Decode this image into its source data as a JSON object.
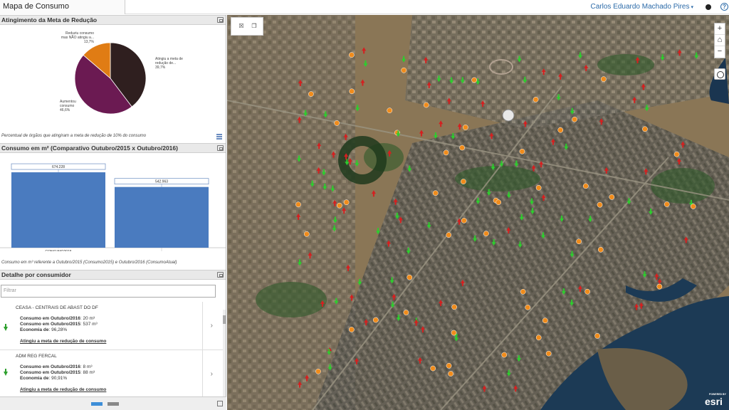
{
  "app": {
    "title": "Mapa de Consumo"
  },
  "header": {
    "user_name": "Carlos Eduardo Machado Pires",
    "caret": "▾"
  },
  "panels": {
    "pie": {
      "title": "Atingimento da Meta de Redução",
      "caption": "Percentual de órgãos que atingiram a meta de redução de 10% do consumo",
      "labels": {
        "reduziu": [
          "Reduziu consumo",
          "mas NÃO atingiu a...",
          "13,7%"
        ],
        "atingiu": [
          "Atingiu a meta de",
          "redução de...",
          "39,7%"
        ],
        "aumentou": [
          "Aumentou",
          "consumo",
          "46,6%"
        ]
      }
    },
    "bar": {
      "title": "Consumo em m² (Comparativo Outubro/2015 x Outubro/2016)",
      "caption": "Consumo em m³ referente a Outubro/2015 (Consumo2015) e Outubro/2016 (ConsumoAtual)"
    },
    "detail": {
      "title": "Detalhe por consumidor",
      "filter_placeholder": "Filtrar"
    }
  },
  "chart_data": [
    {
      "type": "pie",
      "title": "Atingimento da Meta de Redução",
      "slices": [
        {
          "label": "Atingiu a meta de redução de...",
          "value": 39.7,
          "color": "#2f1f1f"
        },
        {
          "label": "Aumentou consumo",
          "value": 46.6,
          "color": "#6b1a52"
        },
        {
          "label": "Reduziu consumo mas NÃO atingiu a...",
          "value": 13.7,
          "color": "#e07c14"
        }
      ]
    },
    {
      "type": "bar",
      "title": "Consumo em m² (Comparativo Outubro/2015 x Outubro/2016)",
      "categories": [
        "CONSUMO2015",
        "CONSUMOATUAL"
      ],
      "values": [
        674228,
        542963
      ],
      "value_labels": [
        "674.228",
        "542.963"
      ],
      "color": "#4a7bbf"
    }
  ],
  "consumers": [
    {
      "name": "CEASA - CENTRAIS DE ABAST DO DF",
      "l1_label": "Consumo em Outubro/2016",
      "l1_value": ": 20 m³",
      "l2_label": "Consumo em Outubro/2015",
      "l2_value": ": 537 m³",
      "l3_label": "Economia de",
      "l3_value": ": 96,28%",
      "status": "Atingiu a meta de redução de consumo"
    },
    {
      "name": "ADM REG FERCAL",
      "l1_label": "Consumo em Outubro/2016",
      "l1_value": ": 8 m³",
      "l2_label": "Consumo em Outubro/2015",
      "l2_value": ": 88 m³",
      "l3_label": "Economia de",
      "l3_value": ": 90,91%",
      "status": "Atingiu a meta de redução de consumo"
    }
  ],
  "map": {
    "zoom_in": "+",
    "home": "⌂",
    "zoom_out": "−",
    "attribution_small": "POWERED BY",
    "attribution": "esri",
    "marker_colors": {
      "green": "#2ecc2e",
      "red": "#d42020",
      "orange": "#f08c1c"
    }
  }
}
